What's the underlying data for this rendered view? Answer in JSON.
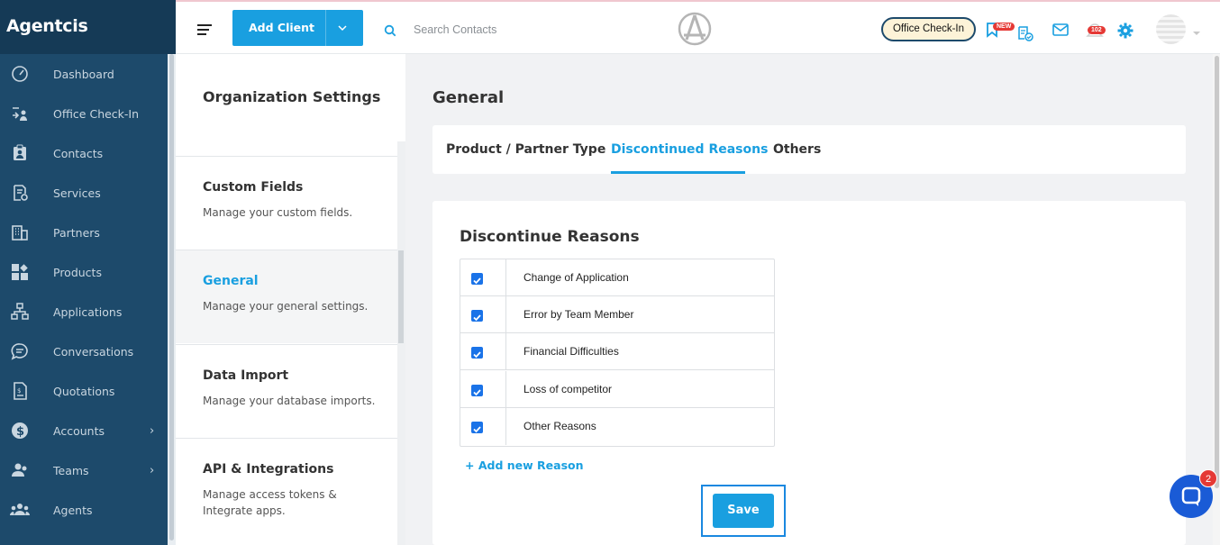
{
  "app": {
    "brand": "Agentcis"
  },
  "sidebar": {
    "items": [
      {
        "label": "Dashboard",
        "icon": "dashboard-gauge-icon"
      },
      {
        "label": "Office Check-In",
        "icon": "check-in-icon"
      },
      {
        "label": "Contacts",
        "icon": "contacts-badge-icon"
      },
      {
        "label": "Services",
        "icon": "services-doc-icon"
      },
      {
        "label": "Partners",
        "icon": "building-icon"
      },
      {
        "label": "Products",
        "icon": "products-grid-icon"
      },
      {
        "label": "Applications",
        "icon": "workflow-icon"
      },
      {
        "label": "Conversations",
        "icon": "chat-bubble-icon"
      },
      {
        "label": "Quotations",
        "icon": "quotation-doc-icon"
      },
      {
        "label": "Accounts",
        "icon": "dollar-icon",
        "has_submenu": true
      },
      {
        "label": "Teams",
        "icon": "team-icon",
        "has_submenu": true
      },
      {
        "label": "Agents",
        "icon": "agents-group-icon"
      }
    ]
  },
  "header": {
    "add_client_label": "Add Client",
    "search_placeholder": "Search Contacts",
    "office_checkin_label": "Office Check-In",
    "new_badge": "NEW",
    "notification_count": "102"
  },
  "settings_panel": {
    "title": "Organization Settings",
    "items": [
      {
        "title": "Custom Fields",
        "desc": "Manage your custom fields.",
        "active": false
      },
      {
        "title": "General",
        "desc": "Manage your general settings.",
        "active": true
      },
      {
        "title": "Data Import",
        "desc": "Manage your database imports.",
        "active": false
      },
      {
        "title": "API & Integrations",
        "desc": "Manage access tokens & Integrate apps.",
        "active": false
      }
    ]
  },
  "main": {
    "title": "General",
    "tabs": [
      {
        "label": "Product / Partner Type",
        "active": false
      },
      {
        "label": "Discontinued Reasons",
        "active": true
      },
      {
        "label": "Others",
        "active": false
      }
    ],
    "card_title": "Discontinue Reasons",
    "reasons": [
      {
        "label": "Change of Application",
        "checked": true
      },
      {
        "label": "Error by Team Member",
        "checked": true
      },
      {
        "label": "Financial Difficulties",
        "checked": true
      },
      {
        "label": "Loss of competitor",
        "checked": true
      },
      {
        "label": "Other Reasons",
        "checked": true
      }
    ],
    "add_reason_label": "Add new Reason",
    "save_label": "Save"
  },
  "chat": {
    "unread": "2"
  },
  "colors": {
    "sidebar_bg": "#1d4a6b",
    "accent": "#199fe0",
    "checkbox": "#1a73e8",
    "badge": "#e53935"
  }
}
